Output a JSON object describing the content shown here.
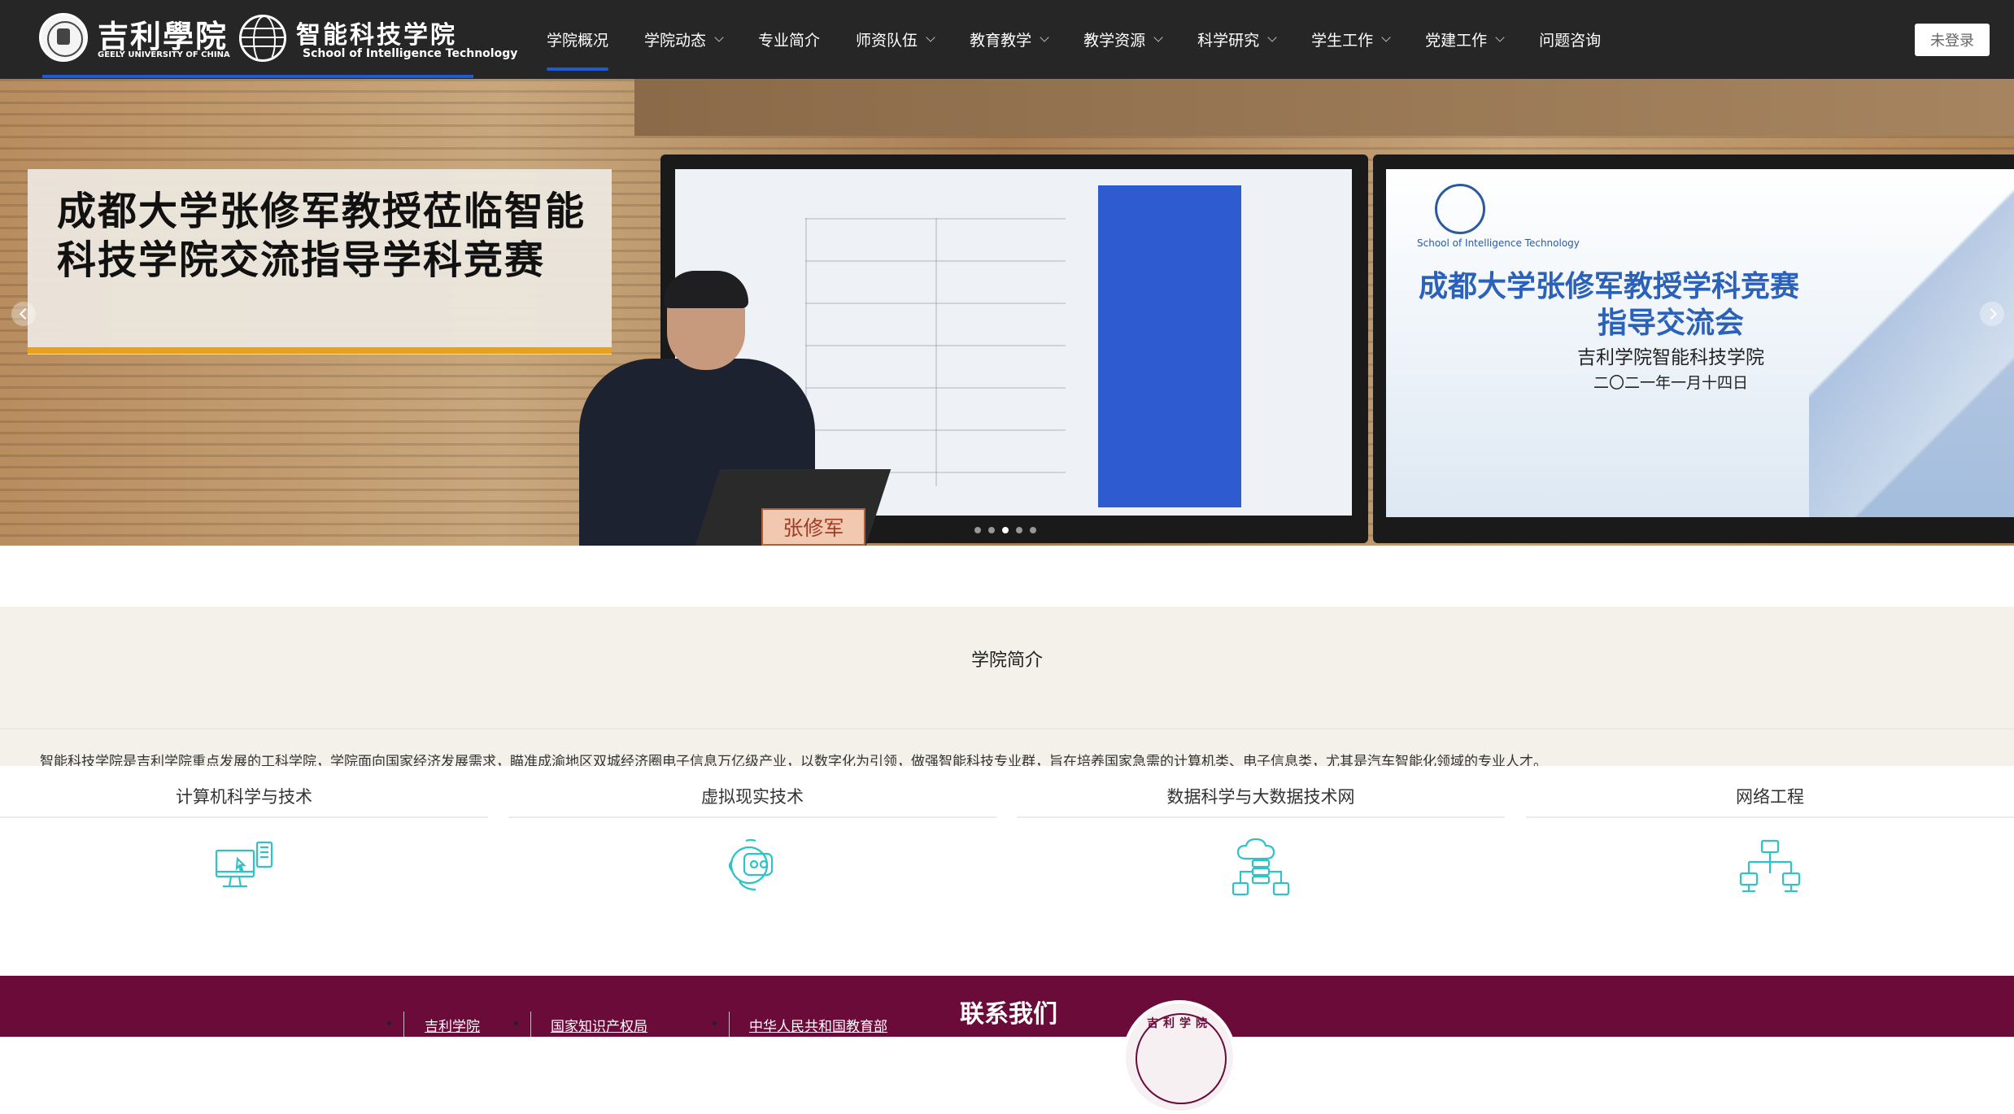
{
  "header": {
    "logo_cn": "吉利學院",
    "logo_en": "GEELY UNIVERSITY OF CHINA",
    "school_cn": "智能科技学院",
    "school_en": "School of Intelligence Technology",
    "login_label": "未登录"
  },
  "nav": [
    {
      "label": "学院概况",
      "dropdown": false,
      "active": true
    },
    {
      "label": "学院动态",
      "dropdown": true
    },
    {
      "label": "专业简介",
      "dropdown": false
    },
    {
      "label": "师资队伍",
      "dropdown": true
    },
    {
      "label": "教育教学",
      "dropdown": true
    },
    {
      "label": "教学资源",
      "dropdown": true
    },
    {
      "label": "科学研究",
      "dropdown": true
    },
    {
      "label": "学生工作",
      "dropdown": true
    },
    {
      "label": "党建工作",
      "dropdown": true
    },
    {
      "label": "问题咨询",
      "dropdown": false
    }
  ],
  "banner": {
    "caption": "成都大学张修军教授莅临智能科技学院交流指导学科竞赛",
    "screen_small": "School of Intelligence Technology",
    "screen_title1": "成都大学张修军教授学科竞赛",
    "screen_title2": "指导交流会",
    "screen_sub1": "吉利学院智能科技学院",
    "screen_sub2": "二〇二一年一月十四日",
    "nameplate": "张修军",
    "slide_count": 5,
    "active_slide": 3
  },
  "intro": {
    "title": "学院简介",
    "text": "智能科技学院是吉利学院重点发展的工科学院，学院面向国家经济发展需求，瞄准成渝地区双城经济圈电子信息万亿级产业，以数字化为引领，做强智能科技专业群，旨在培养国家急需的计算机类、电子信息类，尤其是汽车智能化领域的专业人才。"
  },
  "majors": [
    {
      "title": "计算机科学与技术",
      "icon": "computer-icon"
    },
    {
      "title": "虚拟现实技术",
      "icon": "vr-headset-icon"
    },
    {
      "title": "数据科学与大数据技术网",
      "icon": "cloud-data-icon"
    },
    {
      "title": "网络工程",
      "icon": "network-icon"
    }
  ],
  "footer": {
    "links": [
      "吉利学院",
      "国家知识产权局",
      "中华人民共和国教育部"
    ],
    "contact_title": "联系我们",
    "seal_text": "吉利学院"
  },
  "colors": {
    "header_bg": "#262626",
    "accent_blue": "#1d5bd6",
    "icon_teal": "#2fc2c6",
    "footer_bg": "#6b0b3a",
    "caption_bar": "#e8a11d"
  }
}
